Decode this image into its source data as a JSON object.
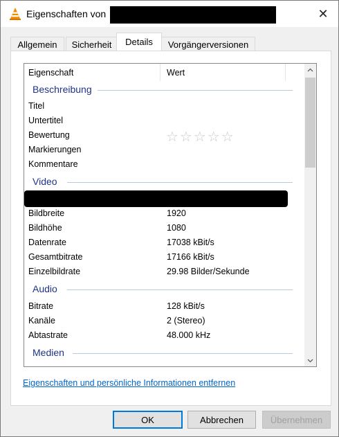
{
  "window": {
    "title": "Eigenschaften von",
    "close_glyph": "✕"
  },
  "tabs": [
    {
      "label": "Allgemein"
    },
    {
      "label": "Sicherheit"
    },
    {
      "label": "Details"
    },
    {
      "label": "Vorgängerversionen"
    }
  ],
  "active_tab": "Details",
  "list": {
    "header_property": "Eigenschaft",
    "header_value": "Wert",
    "groups": {
      "beschreibung": "Beschreibung",
      "video": "Video",
      "audio": "Audio",
      "medien": "Medien"
    },
    "beschreibung_rows": [
      {
        "label": "Titel",
        "value": ""
      },
      {
        "label": "Untertitel",
        "value": ""
      },
      {
        "label": "Bewertung",
        "value": "☆☆☆☆☆"
      },
      {
        "label": "Markierungen",
        "value": ""
      },
      {
        "label": "Kommentare",
        "value": ""
      }
    ],
    "video_rows": [
      {
        "label": "Bildbreite",
        "value": "1920"
      },
      {
        "label": "Bildhöhe",
        "value": "1080"
      },
      {
        "label": "Datenrate",
        "value": "17038 kBit/s"
      },
      {
        "label": "Gesamtbitrate",
        "value": "17166 kBit/s"
      },
      {
        "label": "Einzelbildrate",
        "value": "29.98 Bilder/Sekunde"
      }
    ],
    "audio_rows": [
      {
        "label": "Bitrate",
        "value": "128 kBit/s"
      },
      {
        "label": "Kanäle",
        "value": "2 (Stereo)"
      },
      {
        "label": "Abtastrate",
        "value": "48.000 kHz"
      }
    ]
  },
  "remove_link": "Eigenschaften und persönliche Informationen entfernen",
  "buttons": {
    "ok": "OK",
    "cancel": "Abbrechen",
    "apply": "Übernehmen"
  },
  "colors": {
    "accent": "#0078d7",
    "group_heading": "#1e3287",
    "link": "#0066cc",
    "annotation_arrow": "#e60000"
  }
}
